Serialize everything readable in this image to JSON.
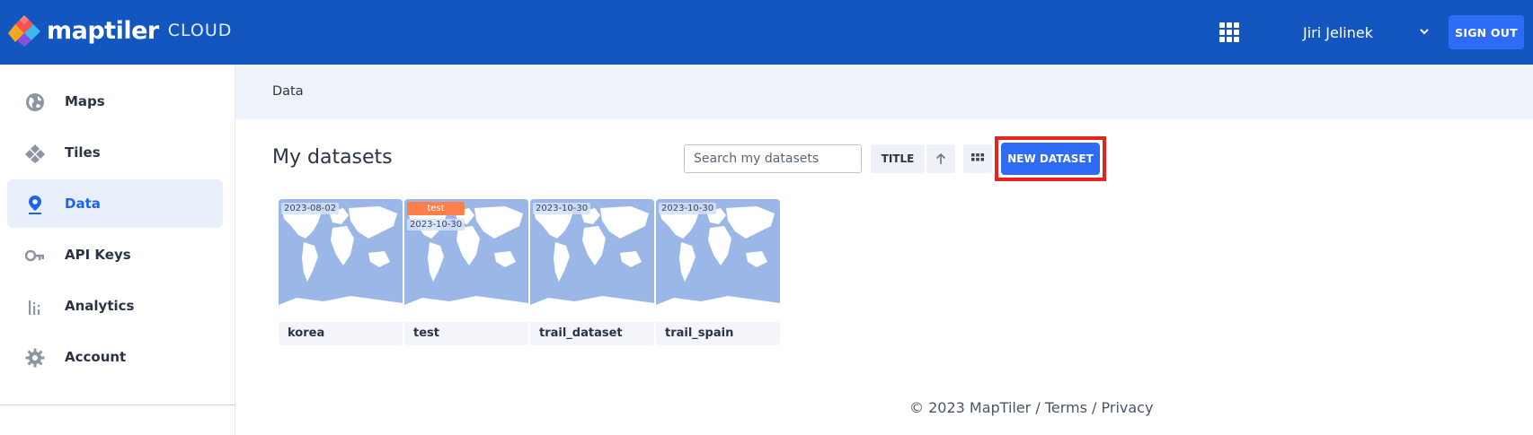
{
  "header": {
    "brand": "maptiler",
    "brand_sub": "CLOUD",
    "user_name": "Jiri Jelinek",
    "signout_label": "SIGN OUT"
  },
  "sidebar": {
    "items": [
      {
        "label": "Maps",
        "icon": "globe-icon"
      },
      {
        "label": "Tiles",
        "icon": "tiles-icon"
      },
      {
        "label": "Data",
        "icon": "pin-icon",
        "active": true
      },
      {
        "label": "API Keys",
        "icon": "key-icon"
      },
      {
        "label": "Analytics",
        "icon": "analytics-icon"
      },
      {
        "label": "Account",
        "icon": "gear-icon"
      }
    ]
  },
  "breadcrumb": "Data",
  "main": {
    "title": "My datasets",
    "search_placeholder": "Search my datasets",
    "sort_label": "TITLE",
    "new_dataset_label": "NEW DATASET"
  },
  "datasets": [
    {
      "name": "korea",
      "date": "2023-08-02",
      "tag": ""
    },
    {
      "name": "test",
      "date": "2023-10-30",
      "tag": "test"
    },
    {
      "name": "trail_dataset",
      "date": "2023-10-30",
      "tag": ""
    },
    {
      "name": "trail_spain",
      "date": "2023-10-30",
      "tag": ""
    }
  ],
  "footer": {
    "copyright": "© 2023 MapTiler",
    "sep": " / ",
    "terms": "Terms",
    "privacy": "Privacy"
  },
  "colors": {
    "header_bg": "#1456c0",
    "accent": "#2f6cf5",
    "highlight": "#e8231f",
    "tag": "#ff7f4a"
  }
}
